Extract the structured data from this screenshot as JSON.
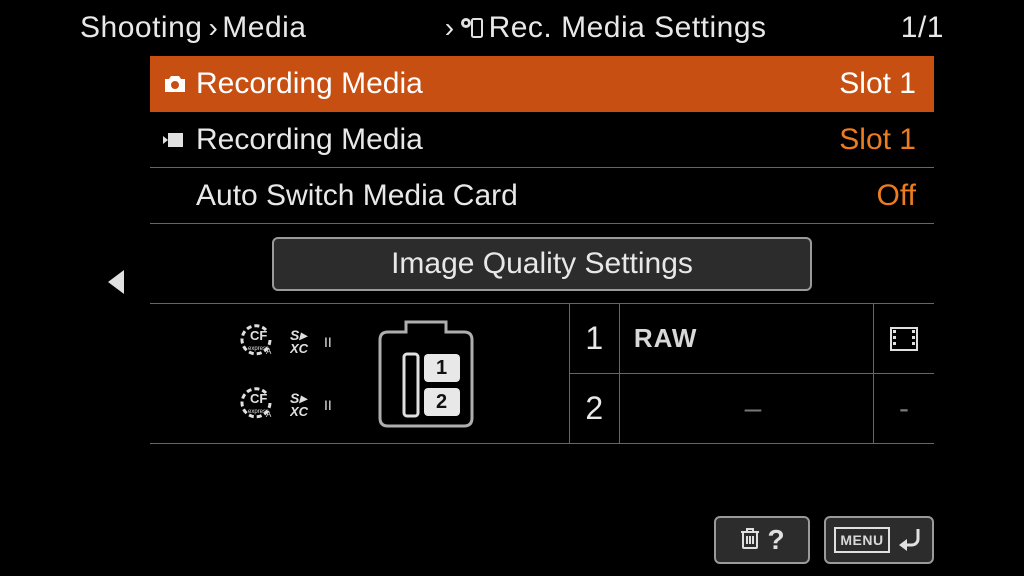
{
  "breadcrumb": {
    "items": [
      "Shooting",
      "Media",
      "Rec. Media Settings"
    ],
    "page": "1/1"
  },
  "menu": {
    "items": [
      {
        "icon": "photo",
        "label": "Recording Media",
        "value": "Slot 1",
        "selected": true
      },
      {
        "icon": "video",
        "label": "Recording Media",
        "value": "Slot 1",
        "selected": false,
        "accent": true
      },
      {
        "icon": "",
        "label": "Auto Switch Media Card",
        "value": "Off",
        "selected": false,
        "accent": true
      }
    ],
    "image_quality_button": "Image Quality Settings"
  },
  "slots": [
    {
      "num": "1",
      "format": "RAW",
      "video": true
    },
    {
      "num": "2",
      "format": "–",
      "video": false
    }
  ],
  "card_types": {
    "cf": "CFexpress A",
    "sd": "SDXC II"
  },
  "footer": {
    "help": "?",
    "menu_label": "MENU"
  },
  "colors": {
    "accent": "#ec7c1e",
    "highlight": "#c74f12"
  }
}
